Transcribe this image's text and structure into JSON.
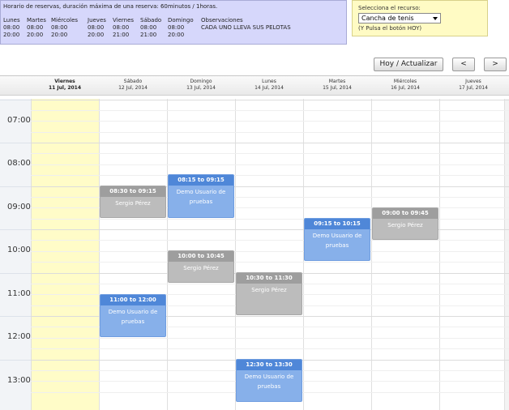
{
  "schedule": {
    "title": "Horario de reservas, duración máxima de una reserva: 60minutos / 1horas.",
    "days": [
      {
        "name": "Lunes",
        "open": "08:00",
        "close": "20:00"
      },
      {
        "name": "Martes",
        "open": "08:00",
        "close": "20:00"
      },
      {
        "name": "Miércoles",
        "open": "08:00",
        "close": "20:00"
      },
      {
        "name": "Jueves",
        "open": "08:00",
        "close": "20:00"
      },
      {
        "name": "Viernes",
        "open": "08:00",
        "close": "21:00"
      },
      {
        "name": "Sábado",
        "open": "08:00",
        "close": "21:00"
      },
      {
        "name": "Domingo",
        "open": "08:00",
        "close": "20:00"
      }
    ],
    "observations_label": "Observaciones",
    "observations_text": "CADA UNO LLEVA SUS PELOTAS"
  },
  "resource": {
    "label": "Selecciona el recurso:",
    "selected": "Cancha de tenis",
    "hint": "(Y Pulsa el botón HOY)"
  },
  "nav": {
    "today_label": "Hoy / Actualizar",
    "prev_label": "<",
    "next_label": ">"
  },
  "calendar": {
    "columns": [
      {
        "day": "Viernes",
        "date": "11 Jul, 2014",
        "today": true
      },
      {
        "day": "Sábado",
        "date": "12 Jul, 2014"
      },
      {
        "day": "Domingo",
        "date": "13 Jul, 2014"
      },
      {
        "day": "Lunes",
        "date": "14 Jul, 2014"
      },
      {
        "day": "Martes",
        "date": "15 Jul, 2014"
      },
      {
        "day": "Miércoles",
        "date": "16 Jul, 2014"
      },
      {
        "day": "Jueves",
        "date": "17 Jul, 2014"
      }
    ],
    "hours": [
      "07:00",
      "08:00",
      "09:00",
      "10:00",
      "11:00",
      "12:00",
      "13:00"
    ],
    "events": [
      {
        "col": 1,
        "start": "08:30",
        "end": "09:15",
        "time_label": "08:30 to 09:15",
        "text": "Sergio Pérez",
        "color": "gray"
      },
      {
        "col": 2,
        "start": "08:15",
        "end": "09:15",
        "time_label": "08:15 to 09:15",
        "text": "Demo Usuario de pruebas",
        "color": "blue"
      },
      {
        "col": 2,
        "start": "10:00",
        "end": "10:45",
        "time_label": "10:00 to 10:45",
        "text": "Sergio Pérez",
        "color": "gray"
      },
      {
        "col": 3,
        "start": "10:30",
        "end": "11:30",
        "time_label": "10:30 to 11:30",
        "text": "Sergio Pérez",
        "color": "gray"
      },
      {
        "col": 4,
        "start": "09:15",
        "end": "10:15",
        "time_label": "09:15 to 10:15",
        "text": "Demo Usuario de pruebas",
        "color": "blue"
      },
      {
        "col": 5,
        "start": "09:00",
        "end": "09:45",
        "time_label": "09:00 to 09:45",
        "text": "Sergio Pérez",
        "color": "gray"
      },
      {
        "col": 1,
        "start": "11:00",
        "end": "12:00",
        "time_label": "11:00 to 12:00",
        "text": "Demo Usuario de pruebas",
        "color": "blue"
      },
      {
        "col": 3,
        "start": "12:30",
        "end": "13:30",
        "time_label": "12:30 to 13:30",
        "text": "Demo Usuario de pruebas",
        "color": "blue"
      }
    ]
  }
}
